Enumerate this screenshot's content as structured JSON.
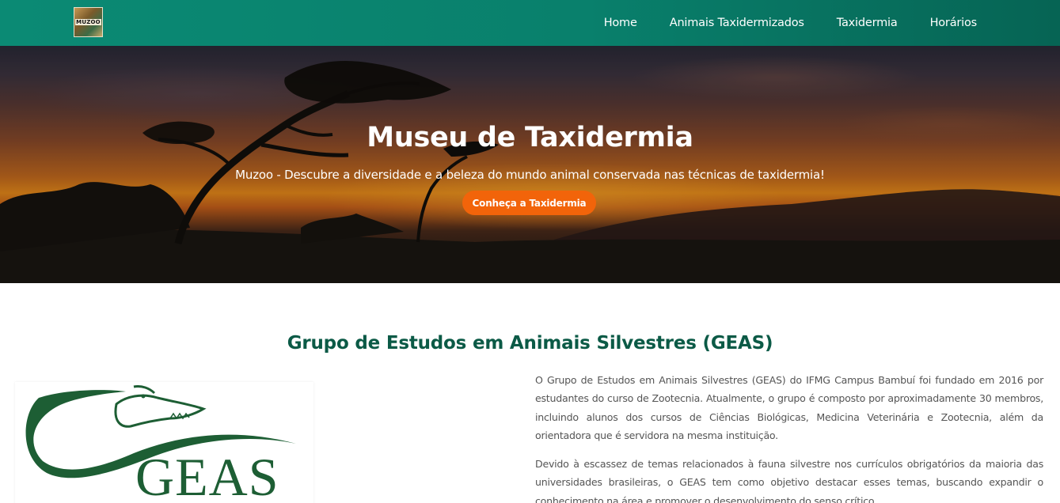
{
  "nav": {
    "logo_text": "MUZOO",
    "links": [
      "Home",
      "Animais Taxidermizados",
      "Taxidermia",
      "Horários"
    ]
  },
  "hero": {
    "title": "Museu de Taxidermia",
    "subtitle": "Muzoo - Descubre a diversidade e a beleza do mundo animal conservada nas técnicas de taxidermia!",
    "button_label": "Conheça a Taxidermia"
  },
  "section": {
    "title": "Grupo de Estudos em Animais Silvestres (GEAS)",
    "logo_text": "GEAS",
    "paragraphs": [
      "O Grupo de Estudos em Animais Silvestres (GEAS) do IFMG Campus Bambuí foi fundado em 2016 por estudantes do curso de Zootecnia. Atualmente, o grupo é composto por aproximadamente 30 membros, incluindo alunos dos cursos de Ciências Biológicas, Medicina Veterinária e Zootecnia, além da orientadora que é servidora na mesma instituição.",
      "Devido à escassez de temas relacionados à fauna silvestre nos currículos obrigatórios da maioria das universidades brasileiras, o GEAS tem como objetivo destacar esses temas, buscando expandir o conhecimento na área e promover o desenvolvimento do senso crítico"
    ]
  },
  "colors": {
    "nav_bg": "#0b8a74",
    "accent_orange": "#f2640a",
    "heading_green": "#0b5a46"
  }
}
